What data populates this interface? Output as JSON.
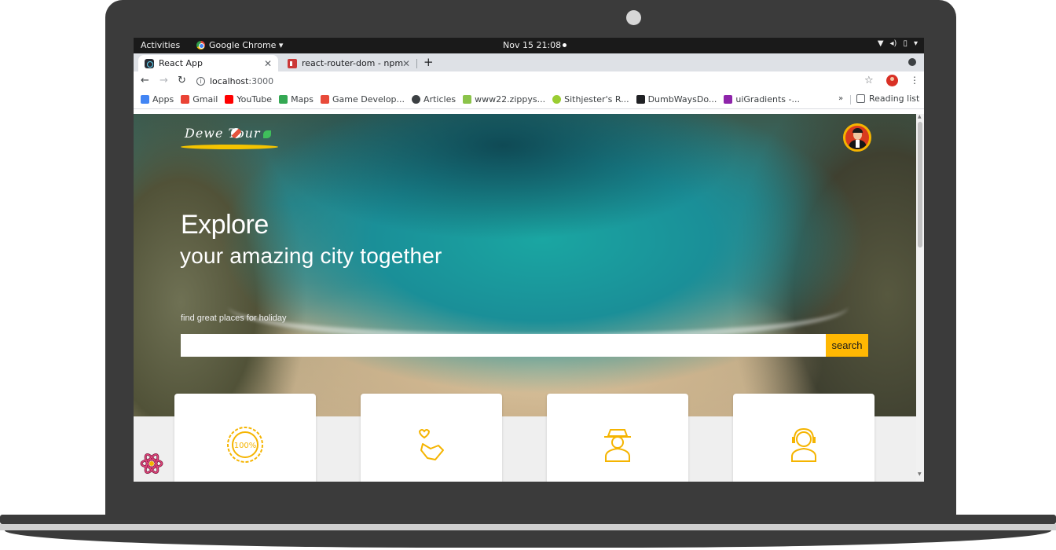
{
  "gnome": {
    "activities": "Activities",
    "app": "Google Chrome ▾",
    "clock": "Nov 15  21:08"
  },
  "tabs": [
    {
      "title": "React App"
    },
    {
      "title": "react-router-dom - npm"
    }
  ],
  "toolbar": {
    "url_host": "localhost",
    "url_port": ":3000"
  },
  "bookmarks": {
    "items": [
      {
        "label": "Apps",
        "color": "#4285f4"
      },
      {
        "label": "Gmail",
        "color": "#ea4335"
      },
      {
        "label": "YouTube",
        "color": "#ff0000"
      },
      {
        "label": "Maps",
        "color": "#34a853"
      },
      {
        "label": "Game Develop...",
        "color": "#e84a3a"
      },
      {
        "label": "Articles",
        "color": "#3c4043"
      },
      {
        "label": "www22.zippys...",
        "color": "#8bc34a"
      },
      {
        "label": "Sithjester's R...",
        "color": "#9acd32"
      },
      {
        "label": "DumbWaysDo...",
        "color": "#202124"
      },
      {
        "label": "uiGradients -...",
        "color": "#8e24aa"
      }
    ],
    "more": "»",
    "reading_list": "Reading list"
  },
  "page": {
    "logo_text": "Dewe Tour",
    "hero_title": "Explore",
    "hero_subtitle": "your amazing city together",
    "hero_hint": "find great places for holiday",
    "search_value": "",
    "search_button": "search"
  },
  "cards": [
    {
      "icon": "guarantee-badge-icon"
    },
    {
      "icon": "hand-heart-icon"
    },
    {
      "icon": "agent-icon"
    },
    {
      "icon": "support-headset-icon"
    }
  ],
  "colors": {
    "accent": "#ffb803"
  }
}
